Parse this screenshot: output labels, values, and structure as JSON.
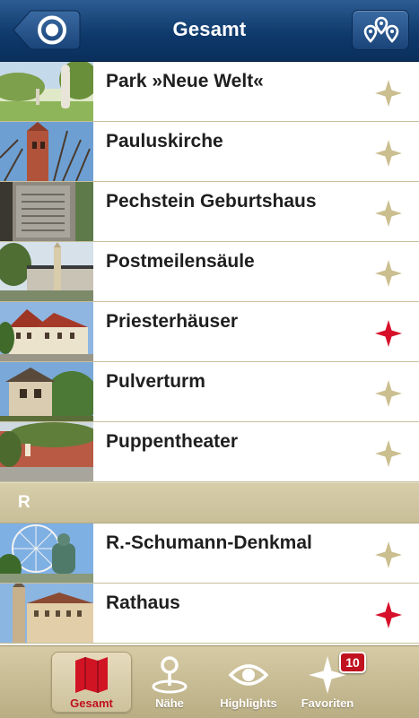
{
  "navbar": {
    "title": "Gesamt",
    "back_icon": "target-icon",
    "map_icon": "map-pins-icon"
  },
  "colors": {
    "nav": "#0f3a6c",
    "accent": "#c0101e",
    "star_off": "#cbbf90",
    "star_on": "#d6102a",
    "section": "#cfc6a2"
  },
  "items": [
    {
      "label": "Park »Neue Welt«",
      "favorite": false
    },
    {
      "label": "Pauluskirche",
      "favorite": false
    },
    {
      "label": "Pechstein Geburtshaus",
      "favorite": false
    },
    {
      "label": "Postmeilensäule",
      "favorite": false
    },
    {
      "label": "Priesterhäuser",
      "favorite": true
    },
    {
      "label": "Pulverturm",
      "favorite": false
    },
    {
      "label": "Puppentheater",
      "favorite": false
    }
  ],
  "section": {
    "label": "R"
  },
  "items_r": [
    {
      "label": "R.-Schumann-Denkmal",
      "favorite": false
    },
    {
      "label": "Rathaus",
      "favorite": true
    }
  ],
  "tabs": [
    {
      "label": "Gesamt",
      "icon": "map-icon",
      "active": true
    },
    {
      "label": "Nähe",
      "icon": "location-pin-icon",
      "active": false
    },
    {
      "label": "Highlights",
      "icon": "eye-icon",
      "active": false
    },
    {
      "label": "Favoriten",
      "icon": "star-icon",
      "active": false
    }
  ],
  "favorites_badge": "10"
}
